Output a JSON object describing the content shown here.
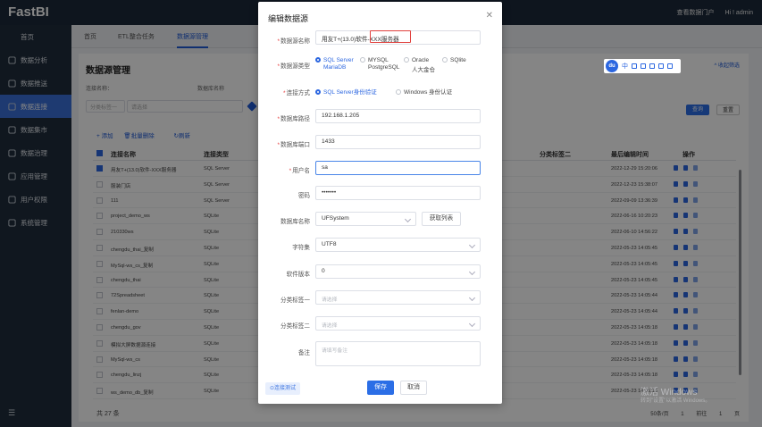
{
  "app": {
    "logo": "FastBI",
    "top_right_link": "查看数据门户",
    "greeting": "Hi ! admin"
  },
  "sidebar": {
    "items": [
      {
        "label": "首页",
        "icon": "home-icon"
      },
      {
        "label": "数据分析",
        "icon": "chart-icon"
      },
      {
        "label": "数据推送",
        "icon": "push-icon"
      },
      {
        "label": "数据连接",
        "icon": "link-icon"
      },
      {
        "label": "数据集市",
        "icon": "cube-icon"
      },
      {
        "label": "数据治理",
        "icon": "shield-icon"
      },
      {
        "label": "应用管理",
        "icon": "app-icon"
      },
      {
        "label": "用户权限",
        "icon": "user-icon"
      },
      {
        "label": "系统管理",
        "icon": "gear-icon"
      }
    ],
    "active_index": 3,
    "footer_icon": "menu-toggle-icon"
  },
  "tabs": [
    {
      "label": "首页"
    },
    {
      "label": "ETL整合任务"
    },
    {
      "label": "数据源管理"
    }
  ],
  "page": {
    "title": "数据源管理",
    "right_link": "^ 收起筛选",
    "filters": {
      "label1": "连接名称：",
      "label2": "数据库名称",
      "select1_placeholder": "分类标签一",
      "select2_placeholder": "请选择"
    },
    "query_btn": "查询",
    "reset_btn": "重置",
    "toolbar": {
      "add": "+ 添加",
      "batch_delete": "批量删除",
      "refresh": "刷新"
    },
    "columns": [
      "连接名称",
      "连接类型",
      "分类标签二",
      "最后编辑时间",
      "操作"
    ],
    "rows": [
      {
        "name": "用友T+(13.0)软件-XXX服务器",
        "type": "SQL Server",
        "time": "2022-12-29 15:20:06",
        "checked": true
      },
      {
        "name": "服装门店",
        "type": "SQL Server",
        "time": "2022-12-23 15:38:07",
        "checked": false
      },
      {
        "name": "111",
        "type": "SQL Server",
        "time": "2022-09-09 13:36:39",
        "checked": false
      },
      {
        "name": "project_demo_ws",
        "type": "SQLite",
        "time": "2022-06-16 10:20:23",
        "checked": false
      },
      {
        "name": "210330ws",
        "type": "SQLite",
        "time": "2022-06-10 14:56:22",
        "checked": false
      },
      {
        "name": "chengdu_thai_复制",
        "type": "SQLite",
        "time": "2022-05-23 14:05:45",
        "checked": false
      },
      {
        "name": "MySql-ws_cs_复制",
        "type": "SQLite",
        "time": "2022-05-23 14:05:45",
        "checked": false
      },
      {
        "name": "chengdu_thai",
        "type": "SQLite",
        "time": "2022-05-23 14:05:45",
        "checked": false
      },
      {
        "name": "72Spreadsheet",
        "type": "SQLite",
        "time": "2022-05-23 14:05:44",
        "checked": false
      },
      {
        "name": "fenlan-demo",
        "type": "SQLite",
        "time": "2022-05-23 14:05:44",
        "checked": false
      },
      {
        "name": "chengdu_gov",
        "type": "SQLite",
        "time": "2022-05-23 14:05:18",
        "checked": false
      },
      {
        "name": "模拟大屏数据源连接",
        "type": "SQLite",
        "time": "2022-05-23 14:05:18",
        "checked": false
      },
      {
        "name": "MySql-ws_cs",
        "type": "SQLite",
        "time": "2022-05-23 14:05:18",
        "checked": false
      },
      {
        "name": "chengdu_linzj",
        "type": "SQLite",
        "time": "2022-05-23 14:05:18",
        "checked": false
      },
      {
        "name": "ws_demo_db_复制",
        "type": "SQLite",
        "time": "2022-05-23 14:05:18",
        "checked": false
      }
    ],
    "total": "共 27 条",
    "pager": {
      "page_size": "50条/页",
      "current": "1",
      "goto": "前往",
      "goto_page": "1",
      "unit": "页"
    }
  },
  "dialog": {
    "title": "编辑数据源",
    "fields": {
      "name": {
        "label": "数据源名称",
        "value": "用友T+(13.0)软件-XXX服务器",
        "required": true
      },
      "type": {
        "label": "数据源类型",
        "required": true,
        "options": [
          "SQL Server",
          "MYSQL",
          "Oracle",
          "SQlite",
          "MariaDB",
          "PostgreSQL",
          "人大金仓"
        ],
        "selected": "SQL Server"
      },
      "auth": {
        "label": "连接方式",
        "required": true,
        "options": [
          "SQL Server身份验证",
          "Windows 身份认证"
        ],
        "selected": "SQL Server身份验证"
      },
      "path": {
        "label": "数据库路径",
        "value": "192.168.1.205",
        "required": true
      },
      "port": {
        "label": "数据库端口",
        "value": "1433",
        "required": true
      },
      "user": {
        "label": "用户名",
        "value": "sa",
        "required": true
      },
      "password": {
        "label": "密码",
        "value": "•••••••",
        "required": false
      },
      "dbname": {
        "label": "数据库名称",
        "value": "UFSystem",
        "fetch_btn": "获取列表"
      },
      "charset": {
        "label": "字符集",
        "value": "UTF8"
      },
      "version": {
        "label": "软件版本",
        "value": "0"
      },
      "tag1": {
        "label": "分类标签一",
        "placeholder": "请选择"
      },
      "tag2": {
        "label": "分类标签二",
        "placeholder": "请选择"
      },
      "remark": {
        "label": "备注",
        "placeholder": "请填写备注"
      }
    },
    "test_btn": "⊙连接测试",
    "save_btn": "保存",
    "cancel_btn": "取消"
  },
  "ime": {
    "logo": "du",
    "chars": "中"
  },
  "watermark": {
    "line1": "激活 Windows",
    "line2": "转到\"设置\"以激活 Windows。"
  }
}
